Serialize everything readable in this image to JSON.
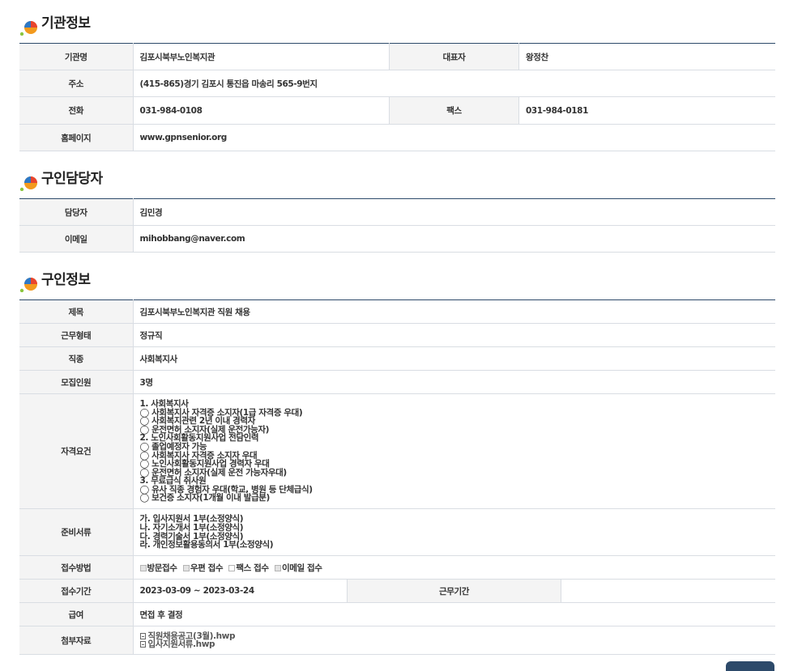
{
  "sections": {
    "org": {
      "title": "기관정보"
    },
    "contact": {
      "title": "구인담당자"
    },
    "job": {
      "title": "구인정보"
    }
  },
  "org": {
    "name_label": "기관명",
    "name": "김포시북부노인복지관",
    "rep_label": "대표자",
    "rep": "왕정찬",
    "addr_label": "주소",
    "addr": "(415-865)경기 김포시 통진읍 마송리 565-9번지",
    "phone_label": "전화",
    "phone": "031-984-0108",
    "fax_label": "팩스",
    "fax": "031-984-0181",
    "home_label": "홈페이지",
    "home": "www.gpnsenior.org"
  },
  "contact": {
    "person_label": "담당자",
    "person": "김민경",
    "email_label": "이메일",
    "email": "mihobbang@naver.com"
  },
  "job": {
    "title_label": "제목",
    "title": "김포시북부노인복지관 직원 채용",
    "type_label": "근무형태",
    "type": "정규직",
    "kind_label": "직종",
    "kind": "사회복지사",
    "count_label": "모집인원",
    "count": "3명",
    "req_label": "자격요건",
    "req_lines": [
      "1. 사회복지사",
      "◯ 사회복지사 자격증 소지자(1급 자격증 우대)",
      "◯ 사회복지관련 2년 이내 경력자",
      "◯ 운전면허 소지자(실제 운전가능자)",
      "2. 노인사회활동지원사업 전담인력",
      "◯ 졸업예정자 가능",
      "◯ 사회복지사 자격증 소지자 우대",
      "◯ 노인사회활동지원사업 경력자 우대",
      "◯ 운전면허 소지자(실제 운전 가능자우대)",
      "3. 무료급식 취사원",
      "◯ 유사 직종 경험자 우대(학교, 병원 등 단체급식)",
      "◯ 보건증 소지자(1개월 이내 발급분)"
    ],
    "docs_label": "준비서류",
    "docs_lines": [
      "가. 입사지원서 1부(소정양식)",
      " 나. 자기소개서 1부(소정양식)",
      " 다. 경력기술서 1부(소정양식)",
      " 라. 개인정보활용동의서 1부(소정양식)"
    ],
    "method_label": "접수방법",
    "methods": [
      {
        "label": "방문접수",
        "checked": true
      },
      {
        "label": "우편 접수",
        "checked": true
      },
      {
        "label": "팩스 접수",
        "checked": false
      },
      {
        "label": "이메일 접수",
        "checked": true
      }
    ],
    "period_label": "접수기간",
    "period": "2023-03-09 ~ 2023-03-24",
    "work_period_label": "근무기간",
    "work_period": "",
    "pay_label": "급여",
    "pay": "면접 후 결정",
    "files_label": "첨부자료",
    "files": [
      "직원채용공고(3월).hwp",
      "입사지원서류.hwp"
    ]
  },
  "colors": {
    "header_line": "#2d4a6a",
    "label_bg": "#f4f4f4",
    "border": "#d9dde3"
  },
  "icons": {
    "section": "colorful-circle-icon",
    "file": "file-icon"
  }
}
